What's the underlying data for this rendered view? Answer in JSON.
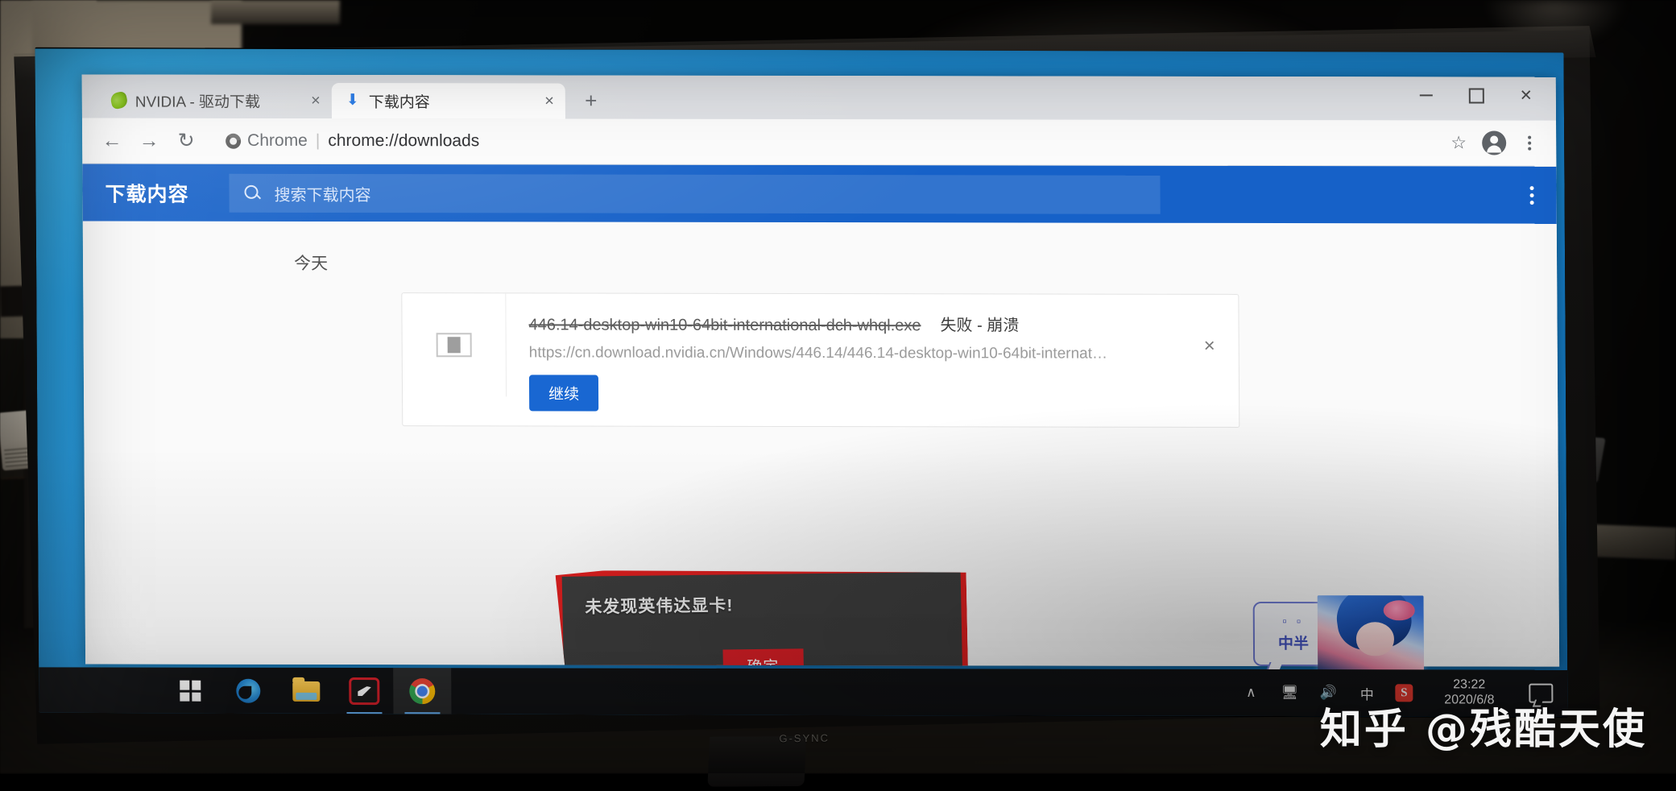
{
  "scene": {
    "description": "photo-of-monitor",
    "monitor_brand_label": "G-SYNC"
  },
  "browser": {
    "tabs": [
      {
        "label": "NVIDIA - 驱动下载",
        "favicon": "nvidia-eye-icon",
        "active": false,
        "close_glyph": "×"
      },
      {
        "label": "下载内容",
        "favicon": "download-icon",
        "active": true,
        "close_glyph": "×"
      }
    ],
    "new_tab_glyph": "+",
    "window_controls": {
      "minimize": "—",
      "maximize": "□",
      "close": "✕"
    },
    "toolbar": {
      "back_glyph": "←",
      "forward_glyph": "→",
      "reload_glyph": "↻",
      "scheme_label": "Chrome",
      "url_divider": "|",
      "url": "chrome://downloads",
      "bookmark_glyph": "☆",
      "profile_name": "avatar",
      "menu_name": "kebab-menu"
    }
  },
  "downloads_page": {
    "title": "下载内容",
    "search_placeholder": "搜索下载内容",
    "search_value": "",
    "menu_glyph": "more-vertical",
    "date_group": "今天",
    "items": [
      {
        "filename": "446.14-desktop-win10-64bit-international-dch-whql.exe",
        "status": "失败 - 崩溃",
        "url": "https://cn.download.nvidia.cn/Windows/446.14/446.14-desktop-win10-64bit-internat…",
        "action_label": "继续",
        "remove_glyph": "×",
        "file_icon": "exe-file-icon",
        "strikethrough": true
      }
    ]
  },
  "error_dialog": {
    "message": "未发现英伟达显卡!",
    "ok_label": "确定",
    "border_color": "#dc1f1f",
    "body_color": "#3c3c3c",
    "button_color": "#d81f26"
  },
  "taskbar": {
    "start_label": "start-button",
    "items": [
      {
        "name": "windows-start-icon",
        "label": "开始"
      },
      {
        "name": "edge-icon",
        "label": "Microsoft Edge"
      },
      {
        "name": "file-explorer-icon",
        "label": "文件资源管理器"
      },
      {
        "name": "red-app-icon",
        "label": "应用"
      },
      {
        "name": "chrome-icon",
        "label": "Google Chrome"
      }
    ],
    "tray": {
      "overflow_glyph": "∧",
      "network_icon": "network-icon",
      "volume_icon": "volume-icon",
      "ime_label": "中",
      "sogou_label": "S",
      "time": "23:22",
      "date": "2020/6/8",
      "action_center_icon": "action-center-icon"
    },
    "ime_popup": {
      "row1": "▫ ▫",
      "row2": "中半"
    }
  },
  "watermark": {
    "text": "知乎 @残酷天使"
  }
}
